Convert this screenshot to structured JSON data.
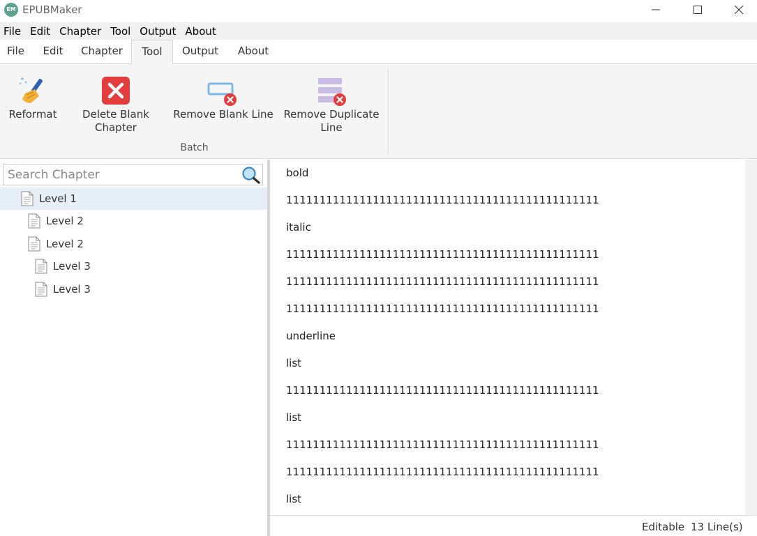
{
  "app": {
    "title": "EPUBMaker",
    "logo_text": "EM",
    "accent_color": "#5aa58f"
  },
  "menubar": {
    "items": [
      "File",
      "Edit",
      "Chapter",
      "Tool",
      "Output",
      "About"
    ]
  },
  "ribbon": {
    "tabs": [
      "File",
      "Edit",
      "Chapter",
      "Tool",
      "Output",
      "About"
    ],
    "active_tab": "Tool",
    "buttons": {
      "reformat": "Reformat",
      "delete_blank_chapter_1": "Delete Blank",
      "delete_blank_chapter_2": "Chapter",
      "remove_blank_line": "Remove Blank Line",
      "remove_duplicate_line_1": "Remove Duplicate",
      "remove_duplicate_line_2": "Line"
    },
    "group_label": "Batch",
    "icons": {
      "reformat": "broom-icon",
      "delete_blank_chapter": "delete-x-icon",
      "remove_blank_line": "blank-line-remove-icon",
      "remove_duplicate_line": "duplicate-line-remove-icon"
    }
  },
  "sidebar": {
    "search_placeholder": "Search Chapter",
    "tree": [
      {
        "label": "Level 1",
        "selected": true
      },
      {
        "label": "Level 2",
        "selected": false
      },
      {
        "label": "Level 2",
        "selected": false
      },
      {
        "label": "Level 3",
        "selected": false
      },
      {
        "label": "Level 3",
        "selected": false
      }
    ]
  },
  "editor": {
    "lines": [
      "bold",
      "11111111111111111111111111111111111111111111111",
      "italic",
      "11111111111111111111111111111111111111111111111",
      "11111111111111111111111111111111111111111111111",
      "11111111111111111111111111111111111111111111111",
      "underline",
      "list",
      "11111111111111111111111111111111111111111111111",
      "list",
      "11111111111111111111111111111111111111111111111",
      "11111111111111111111111111111111111111111111111",
      "list"
    ]
  },
  "status": {
    "mode": "Editable",
    "line_count": "13 Line(s)"
  }
}
